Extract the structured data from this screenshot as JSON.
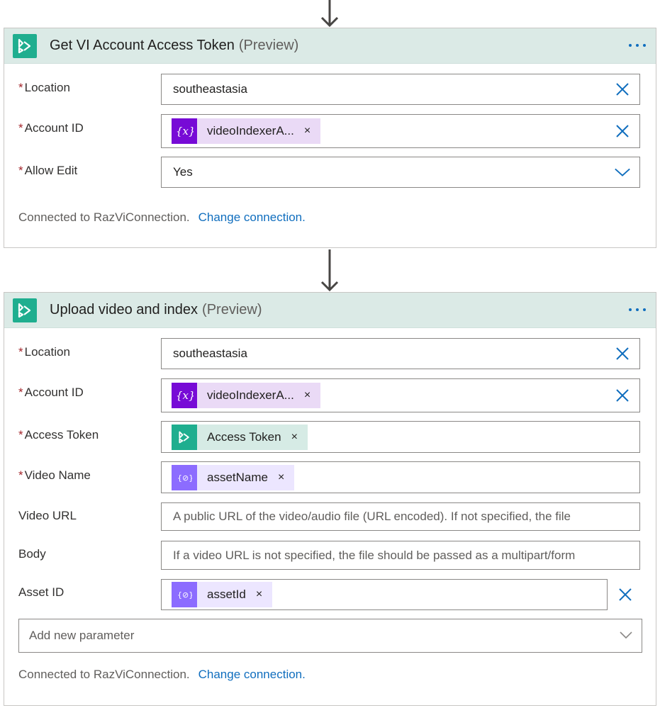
{
  "card1": {
    "title": "Get VI Account Access Token",
    "preview": "(Preview)",
    "fields": {
      "location": {
        "label": "Location",
        "value": "southeastasia"
      },
      "account_id": {
        "label": "Account ID",
        "token": "videoIndexerA..."
      },
      "allow_edit": {
        "label": "Allow Edit",
        "value": "Yes"
      }
    },
    "footer": {
      "connected": "Connected to RazViConnection.",
      "change": "Change connection."
    }
  },
  "card2": {
    "title": "Upload video and index",
    "preview": "(Preview)",
    "fields": {
      "location": {
        "label": "Location",
        "value": "southeastasia"
      },
      "account_id": {
        "label": "Account ID",
        "token": "videoIndexerA..."
      },
      "access_token": {
        "label": "Access Token",
        "token": "Access Token"
      },
      "video_name": {
        "label": "Video Name",
        "token": "assetName"
      },
      "video_url": {
        "label": "Video URL",
        "placeholder": "A public URL of the video/audio file (URL encoded). If not specified, the file"
      },
      "body": {
        "label": "Body",
        "placeholder": "If a video URL is not specified, the file should be passed as a multipart/form"
      },
      "asset_id": {
        "label": "Asset ID",
        "token": "assetId"
      }
    },
    "add_param": "Add new parameter",
    "footer": {
      "connected": "Connected to RazViConnection.",
      "change": "Change connection."
    }
  },
  "required_mark": "*",
  "token_remove": "×",
  "colors": {
    "accent": "#1fae8f",
    "header_bg": "#dbeae6",
    "variable": "#770bd6",
    "param": "#8c6cff",
    "link": "#106ebe",
    "required": "#a4262c"
  },
  "icons": [
    "arrow-down-icon",
    "video-indexer-icon",
    "more-icon",
    "clear-icon",
    "chevron-down-icon",
    "variable-icon",
    "expression-icon"
  ]
}
